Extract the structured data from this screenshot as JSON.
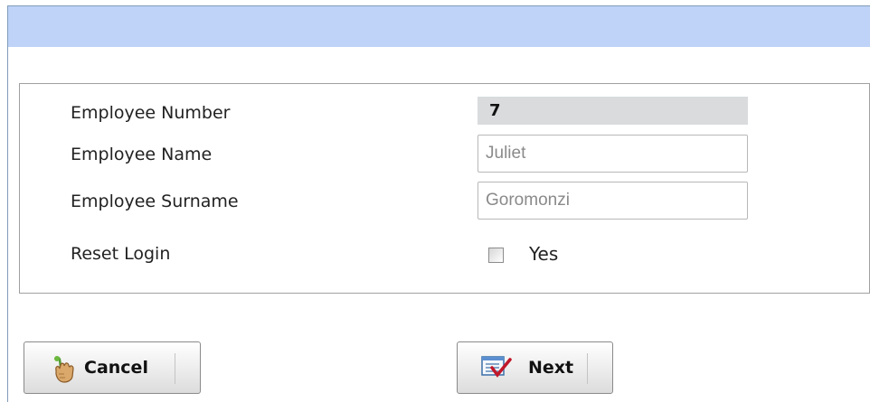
{
  "form": {
    "fields": [
      {
        "label": "Employee Number",
        "value": "7"
      },
      {
        "label": "Employee Name",
        "value": "Juliet"
      },
      {
        "label": "Employee Surname",
        "value": "Goromonzi"
      }
    ],
    "reset_login": {
      "label": "Reset Login",
      "checkbox_label": "Yes",
      "checked": false
    }
  },
  "buttons": {
    "cancel": {
      "label": "Cancel",
      "icon": "hand-pointer-icon"
    },
    "next": {
      "label": "Next",
      "icon": "checklist-icon"
    }
  },
  "colors": {
    "header_band": "#bed3f7",
    "readonly_bg": "#d9dbdd"
  }
}
